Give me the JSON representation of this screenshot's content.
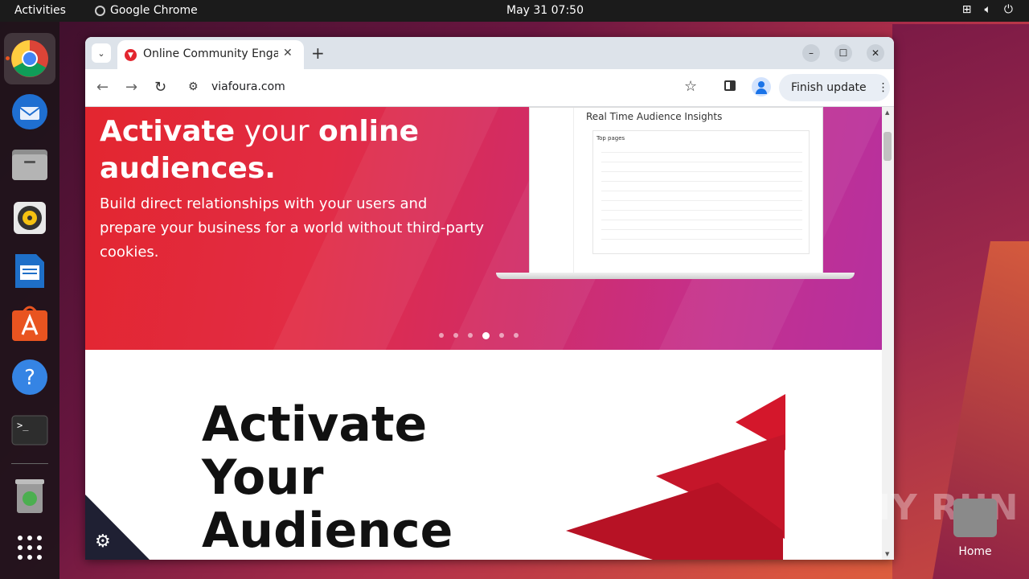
{
  "topbar": {
    "activities": "Activities",
    "app_name": "Google Chrome",
    "clock": "May 31  07:50"
  },
  "dock": {
    "items": [
      "chrome-icon",
      "thunderbird-icon",
      "files-icon",
      "rhythmbox-icon",
      "writer-icon",
      "app-center-icon",
      "help-icon",
      "terminal-icon",
      "trash-icon",
      "show-apps-icon"
    ]
  },
  "browser": {
    "tab_title": "Online Community Engagement",
    "url": "viafoura.com",
    "finish_update": "Finish update",
    "colors": {
      "tabbar": "#dde3ea",
      "accent": "#1a73e8"
    }
  },
  "hero": {
    "heading_bold1": "Activate",
    "heading_light1": " your ",
    "heading_bold2": "online",
    "heading_bold3": "audiences.",
    "subtext": "Build direct relationships with your users and prepare your business for a world without third-party cookies.",
    "dashboard_title": "Real Time Audience Insights",
    "dashboard_card": "Top pages",
    "carousel_active": 4,
    "carousel_count": 6
  },
  "section2": {
    "heading": [
      "Activate",
      "Your",
      "Audience"
    ]
  },
  "desktop": {
    "watermark": "ANY RUN",
    "home_label": "Home"
  }
}
